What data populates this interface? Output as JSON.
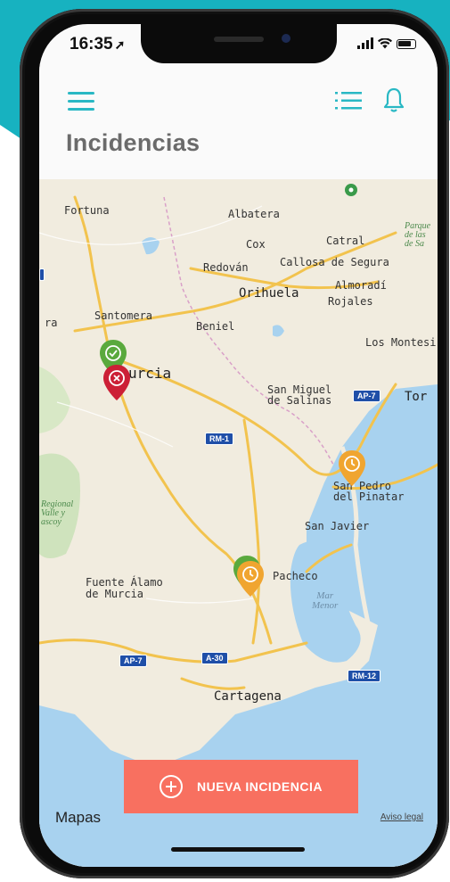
{
  "colors": {
    "accent": "#29b8c4",
    "background_teal": "#17b2c0",
    "title_gray": "#6b6b6b",
    "cta": "#f87060",
    "pin_green": "#5aa93d",
    "pin_red": "#cc1f36",
    "pin_orange": "#f0a530",
    "water": "#a8d2ef",
    "land": "#f1ecdf"
  },
  "status_bar": {
    "time": "16:35",
    "location_icon": "location-arrow-icon",
    "icons": [
      "signal-icon",
      "wifi-icon",
      "battery-icon"
    ]
  },
  "header": {
    "menu_icon": "hamburger-icon",
    "list_icon": "list-view-icon",
    "notifications_icon": "bell-icon",
    "title": "Incidencias"
  },
  "map": {
    "places": {
      "fortuna": "Fortuna",
      "albatera": "Albatera",
      "cox": "Cox",
      "catral": "Catral",
      "parque": "Parque\nde las\nde Sa",
      "redovan": "Redován",
      "callosa": "Callosa de Segura",
      "almoradi": "Almoradí",
      "orihuela": "Orihuela",
      "rojales": "Rojales",
      "santomera": "Santomera",
      "beniel": "Beniel",
      "ra": "ra",
      "los_montesi": "Los Montesi",
      "murcia": "urcia",
      "san_miguel": "San Miguel\nde Salinas",
      "tor": "Tor",
      "san_pedro": "San Pedro\ndel Pinatar",
      "regional": "Regional\nValle y\nascoy",
      "san_javier": "San Javier",
      "fuente_alamo": "Fuente Álamo\nde Murcia",
      "pacheco": "Pacheco",
      "mar_menor": "Mar\nMenor",
      "cartagena": "Cartagena"
    },
    "road_shields": [
      "AP-7",
      "RM-1",
      "AP-7",
      "A-30",
      "RM-12"
    ],
    "pins": [
      {
        "status": "completed",
        "icon": "check-icon",
        "color": "#5aa93d"
      },
      {
        "status": "rejected",
        "icon": "x-icon",
        "color": "#cc1f36"
      },
      {
        "status": "pending",
        "icon": "clock-icon",
        "color": "#f0a530"
      },
      {
        "status": "completed",
        "icon": "check-icon",
        "color": "#5aa93d"
      },
      {
        "status": "pending",
        "icon": "clock-icon",
        "color": "#f0a530"
      }
    ],
    "attribution": "Mapas",
    "legal": "Aviso legal"
  },
  "cta": {
    "label": "NUEVA INCIDENCIA",
    "icon": "plus-circle-icon"
  }
}
